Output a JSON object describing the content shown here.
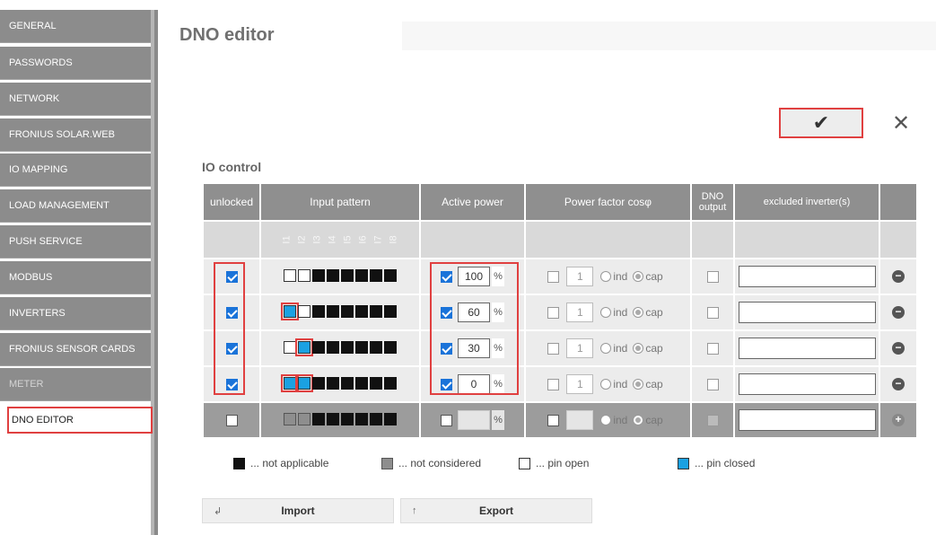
{
  "sidebar": {
    "items": [
      {
        "label": "GENERAL"
      },
      {
        "label": "PASSWORDS"
      },
      {
        "label": "NETWORK"
      },
      {
        "label": "FRONIUS SOLAR.WEB"
      },
      {
        "label": "IO MAPPING"
      },
      {
        "label": "LOAD MANAGEMENT"
      },
      {
        "label": "PUSH SERVICE"
      },
      {
        "label": "MODBUS"
      },
      {
        "label": "INVERTERS"
      },
      {
        "label": "FRONIUS SENSOR CARDS"
      },
      {
        "label": "METER"
      },
      {
        "label": "DNO EDITOR"
      }
    ]
  },
  "header": {
    "title": "DNO editor"
  },
  "toolbar": {
    "confirm_icon": "✔",
    "cancel_icon": "✕"
  },
  "section": {
    "title": "IO control"
  },
  "table": {
    "headers": {
      "unlocked": "unlocked",
      "input_pattern": "Input pattern",
      "active_power": "Active power",
      "power_factor": "Power factor cosφ",
      "dno_output": "DNO output",
      "excluded": "excluded inverter(s)"
    },
    "pin_numbers": [
      "I1",
      "I2",
      "I3",
      "I4",
      "I5",
      "I6",
      "I7",
      "I8"
    ],
    "rows": [
      {
        "unlocked": true,
        "pins": [
          "open",
          "open",
          "na",
          "na",
          "na",
          "na",
          "na",
          "na"
        ],
        "ap_checked": true,
        "ap_value": "100",
        "pf_value": "1",
        "pf_mode": "cap",
        "remove": "−"
      },
      {
        "unlocked": true,
        "pins": [
          "closed",
          "open",
          "na",
          "na",
          "na",
          "na",
          "na",
          "na"
        ],
        "ap_checked": true,
        "ap_value": "60",
        "pf_value": "1",
        "pf_mode": "cap",
        "remove": "−"
      },
      {
        "unlocked": true,
        "pins": [
          "open",
          "closed",
          "na",
          "na",
          "na",
          "na",
          "na",
          "na"
        ],
        "ap_checked": true,
        "ap_value": "30",
        "pf_value": "1",
        "pf_mode": "cap",
        "remove": "−"
      },
      {
        "unlocked": true,
        "pins": [
          "closed",
          "closed",
          "na",
          "na",
          "na",
          "na",
          "na",
          "na"
        ],
        "ap_checked": true,
        "ap_value": "0",
        "pf_value": "1",
        "pf_mode": "cap",
        "remove": "−"
      }
    ],
    "new_row": {
      "pins": [
        "nc",
        "nc",
        "na",
        "na",
        "na",
        "na",
        "na",
        "na"
      ],
      "add": "+"
    },
    "percent": "%",
    "ind": "ind",
    "cap": "cap"
  },
  "legend": {
    "not_applicable": "... not applicable",
    "not_considered": "... not considered",
    "pin_open": "... pin open",
    "pin_closed": "... pin closed"
  },
  "io_buttons": {
    "import_label": "Import",
    "export_label": "Export",
    "import_icon": "↲",
    "export_icon": "↑"
  },
  "colors": {
    "highlight": "#e04040",
    "pin_closed": "#1ba1e2",
    "sidebar": "#8c8c8c",
    "header_cell": "#8f8f8f"
  }
}
